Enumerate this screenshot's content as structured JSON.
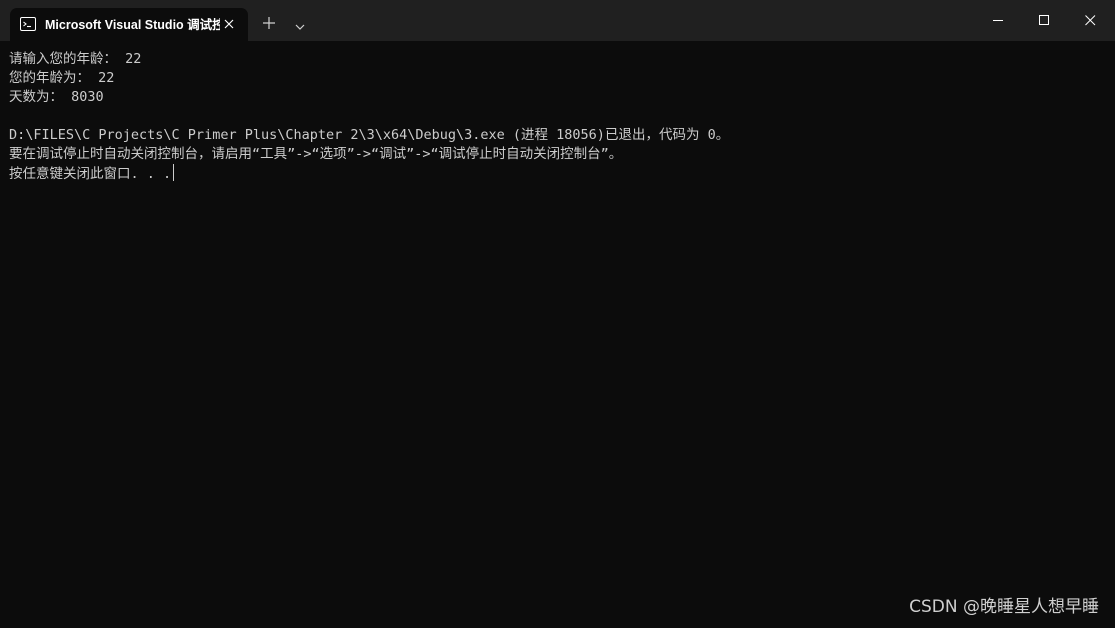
{
  "window": {
    "tab_title": "Microsoft Visual Studio 调试控制台",
    "tab_icon": "terminal-icon",
    "close_tab_icon": "close-icon",
    "new_tab_icon": "plus-icon",
    "dropdown_icon": "chevron-down-icon",
    "controls": {
      "minimize_icon": "minimize-icon",
      "maximize_icon": "maximize-icon",
      "close_icon": "close-icon"
    }
  },
  "terminal": {
    "lines": [
      "请输入您的年龄： 22",
      "您的年龄为： 22",
      "天数为： 8030",
      "",
      "D:\\FILES\\C Projects\\C Primer Plus\\Chapter 2\\3\\x64\\Debug\\3.exe (进程 18056)已退出，代码为 0。",
      "要在调试停止时自动关闭控制台，请启用“工具”->“选项”->“调试”->“调试停止时自动关闭控制台”。",
      "按任意键关闭此窗口. . ."
    ]
  },
  "watermark": "CSDN @晚睡星人想早睡",
  "colors": {
    "titlebar": "#202020",
    "terminal_bg": "#0c0c0c",
    "text": "#cccccc"
  }
}
